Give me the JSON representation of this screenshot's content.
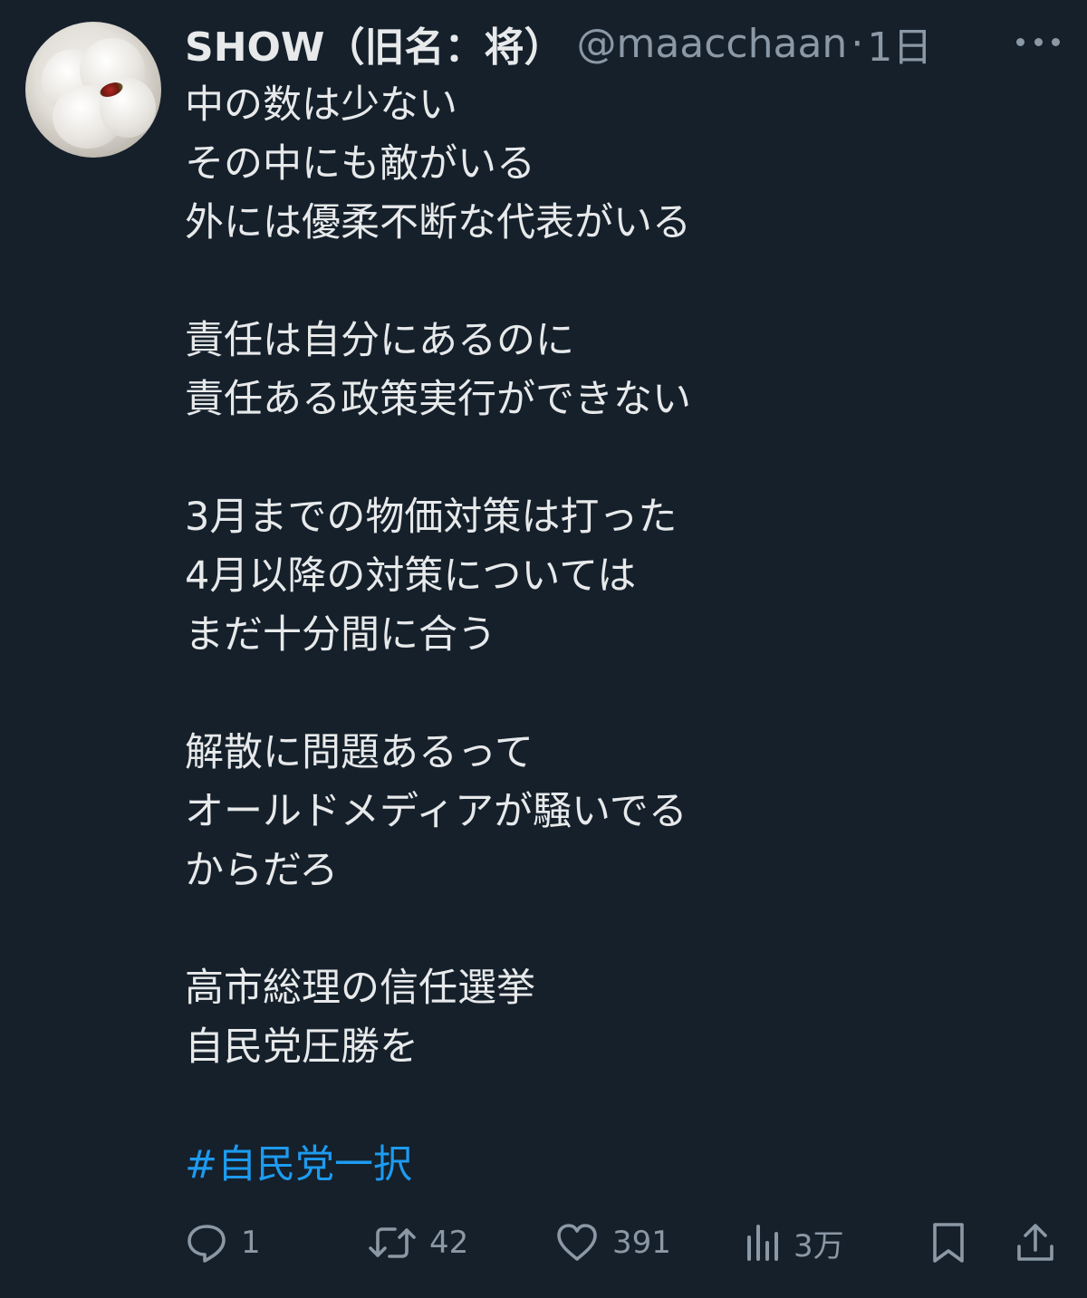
{
  "author": {
    "display_name": "SHOW（旧名：将）",
    "handle": "@maacchaan",
    "separator": "·",
    "time": "1日"
  },
  "body": {
    "lines": [
      "中の数は少ない",
      "その中にも敵がいる",
      "外には優柔不断な代表がいる",
      "",
      "責任は自分にあるのに",
      "責任ある政策実行ができない",
      "",
      "3月までの物価対策は打った",
      "4月以降の対策については",
      "まだ十分間に合う",
      "",
      "解散に問題あるって",
      "オールドメディアが騒いでる",
      "からだろ",
      "",
      "高市総理の信任選挙",
      "自民党圧勝を",
      "",
      ""
    ],
    "hashtag": "#自民党一択"
  },
  "actions": {
    "reply_count": "1",
    "retweet_count": "42",
    "like_count": "391",
    "views_count": "3万"
  },
  "icons": {
    "avatar": "avatar-image",
    "more": "more-dots-icon",
    "reply": "reply-icon",
    "retweet": "retweet-icon",
    "like": "heart-icon",
    "views": "views-chart-icon",
    "bookmark": "bookmark-icon",
    "share": "share-icon"
  },
  "colors": {
    "background": "#15202b",
    "text": "#e7e9ea",
    "secondary_text": "#8b98a5",
    "link": "#1d9bf0"
  }
}
